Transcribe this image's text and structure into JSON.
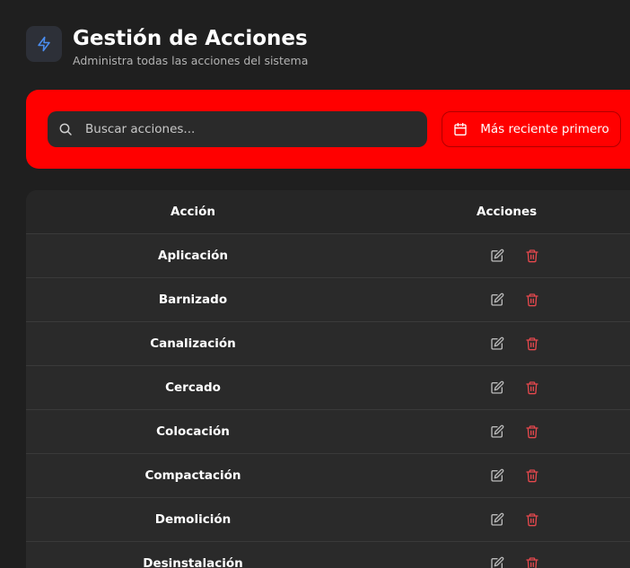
{
  "header": {
    "title": "Gestión de Acciones",
    "subtitle": "Administra todas las acciones del sistema",
    "icon": "lightning-icon"
  },
  "toolbar": {
    "search": {
      "placeholder": "Buscar acciones...",
      "value": "",
      "icon": "search-icon"
    },
    "sort_button": {
      "label": "Más reciente primero",
      "icon": "calendar-icon"
    }
  },
  "table": {
    "columns": [
      "Acción",
      "Acciones"
    ],
    "rows": [
      {
        "name": "Aplicación"
      },
      {
        "name": "Barnizado"
      },
      {
        "name": "Canalización"
      },
      {
        "name": "Cercado"
      },
      {
        "name": "Colocación"
      },
      {
        "name": "Compactación"
      },
      {
        "name": "Demolición"
      },
      {
        "name": "Desinstalación"
      }
    ],
    "row_actions": {
      "edit_icon": "edit-icon",
      "delete_icon": "trash-icon"
    }
  },
  "colors": {
    "background": "#1f1f1f",
    "toolbar": "#ff0000",
    "accent_icon": "#4a8df0",
    "delete": "#e5484d"
  }
}
